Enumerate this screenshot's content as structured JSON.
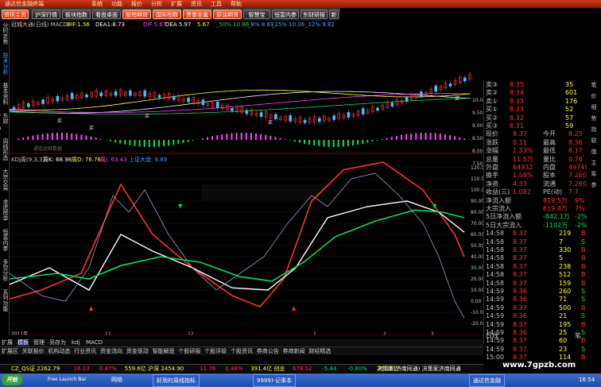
{
  "app": {
    "title": "通达信金融终端",
    "menus": [
      "系统",
      "功能",
      "报价",
      "分析",
      "扩展",
      "资讯",
      "工具",
      "帮助"
    ]
  },
  "nav": {
    "buttons": [
      "资讯主页",
      "沪深行情",
      "板块指数",
      "看盘桌面",
      "股指期货",
      "国际指数",
      "贵重金属",
      "原油期货",
      "智慧宝",
      "恒富内参",
      "东财研报",
      "新"
    ]
  },
  "left_tabs": [
    "分时走势",
    "技术分析",
    "基本资料",
    "东财F10",
    "周线形态",
    "大宗交易",
    "龙虎榜单",
    "恒富内参",
    "多空分析",
    "系列功能"
  ],
  "price_panel": {
    "header": "冠城大通(日线) MACD•",
    "dif": "DIF:1.56",
    "dea": "DEA1:8.73",
    "ma_items": [
      "DIF 5.67",
      "DEA 5.97",
      "5.67",
      "_50% 10.86",
      "_8% 8.69",
      "_25% 10.06",
      "_12% 9.82"
    ],
    "y_labels": [
      "10.00",
      "9.50",
      "9.00",
      "8.50",
      "8.00",
      "7.50"
    ],
    "buy_label": "买",
    "watermark": "通信达财数据"
  },
  "kdj_panel": {
    "header": "KDJ周(9,3,3)",
    "k": "周K: 68.98",
    "d": "周D: 76.76",
    "j": "周J: 63.43",
    "extra": "上证大盘: 8.89",
    "y_labels": [
      "120.00",
      "110.00",
      "100.00",
      "90.00",
      "80.00",
      "70.00",
      "60.00",
      "50.00",
      "40.00",
      "30.00",
      "20.00",
      "10.00",
      "0.00",
      "-10.00",
      "-20.00"
    ],
    "x_labels": [
      "2011年",
      "11",
      "12",
      "1",
      "2",
      "3"
    ]
  },
  "quote": {
    "ask": [
      [
        "卖③",
        "8.35",
        "35"
      ],
      [
        "卖②",
        "8.34",
        "601"
      ],
      [
        "卖①",
        "8.33",
        "176"
      ]
    ],
    "bid": [
      [
        "买①",
        "8.33",
        "52"
      ],
      [
        "买②",
        "8.32",
        "57"
      ],
      [
        "买③",
        "8.31",
        "59"
      ]
    ],
    "stats": [
      [
        "现价",
        "8.37",
        "今开",
        "8.25"
      ],
      [
        "涨跌",
        "0.11",
        "最高",
        "8.36"
      ],
      [
        "涨幅",
        "1.33%",
        "最低",
        "8.17"
      ],
      [
        "总量",
        "11.5万",
        "量比",
        "0.76"
      ],
      [
        "外盘",
        "64932",
        "内盘",
        "49749"
      ],
      [
        "换手",
        "1.58%",
        "股本",
        "7.26亿"
      ],
      [
        "净资",
        "4.33",
        "流通",
        "7.26亿"
      ],
      [
        "收益(三)",
        "1.082",
        "PE(动)",
        "7.7"
      ]
    ],
    "flows": [
      [
        "净流入额",
        "819.5万",
        "9%"
      ],
      [
        "大宗流入",
        "619.4万",
        "7%"
      ],
      [
        "5日净流入额",
        "-842.1万",
        "-2%"
      ],
      [
        "5日大宗流入",
        "-1102万",
        "-2%"
      ]
    ],
    "ticks": [
      [
        "14:58",
        "8.37",
        "219",
        "B"
      ],
      [
        "14:58",
        "8.37",
        "7",
        "S"
      ],
      [
        "14:58",
        "8.37",
        "330",
        "B"
      ],
      [
        "14:58",
        "8.37",
        "5",
        "B"
      ],
      [
        "14:58",
        "8.37",
        "238",
        "B"
      ],
      [
        "14:58",
        "8.37",
        "512",
        "B"
      ],
      [
        "14:58",
        "8.37",
        "159",
        "B"
      ],
      [
        "14:59",
        "8.36",
        "260",
        "S"
      ],
      [
        "14:59",
        "8.36",
        "71",
        "S"
      ],
      [
        "14:59",
        "8.37",
        "500",
        "B"
      ],
      [
        "14:59",
        "8.36",
        "21",
        "S"
      ],
      [
        "14:59",
        "8.37",
        "195",
        "B"
      ],
      [
        "14:59",
        "8.36",
        "25",
        "S"
      ],
      [
        "14:59",
        "8.37",
        "60",
        "B"
      ],
      [
        "14:59",
        "8.37",
        "23",
        "S"
      ],
      [
        "15:00",
        "8.37",
        "114",
        "B"
      ]
    ],
    "bottom_left": "日线",
    "bottom_right": "笔"
  },
  "side_tabs": [
    "笔",
    "价",
    "细",
    "势",
    "指",
    "联",
    "值",
    "主",
    "筹",
    "参"
  ],
  "bottom_tabs": [
    "扩展区",
    "关联报价",
    "机构动态",
    "行业资讯",
    "资金流向",
    "资金驱动",
    "智能解盘",
    "个股研报",
    "个股评级",
    "个股资讯",
    "券商公告",
    "券商新闻",
    "财经精选"
  ],
  "bottom_toolbar": [
    "扩展",
    "模板",
    "管理",
    "另存为",
    "kdj",
    "MACD"
  ],
  "ticker": {
    "items": [
      "CZ_QS证 2262.79",
      "16.03",
      "0.47%",
      "559.6亿 沪深 2454.90",
      "11.78",
      "0.48%",
      "391.4亿 创业",
      "678.52",
      "-5.44",
      "-0.80%",
      "75.25亿"
    ],
    "right": "决策家(济南同通) 决策家济南同通"
  },
  "taskbar": {
    "start": "开始",
    "quick": "Free Launch Bar",
    "items": [
      "网络",
      "好用的周线指标",
      "9999)-记事本",
      "通达信金融"
    ],
    "time": "16:54",
    "watermark": "www.7gpzb.com"
  },
  "colors": {
    "red": "#ff3030",
    "green": "#00e060",
    "cyan": "#40a0ff",
    "white": "#ffffff",
    "kline_white": "#d8d8d8",
    "magenta": "#ff40ff",
    "yellow": "#ffff40"
  }
}
